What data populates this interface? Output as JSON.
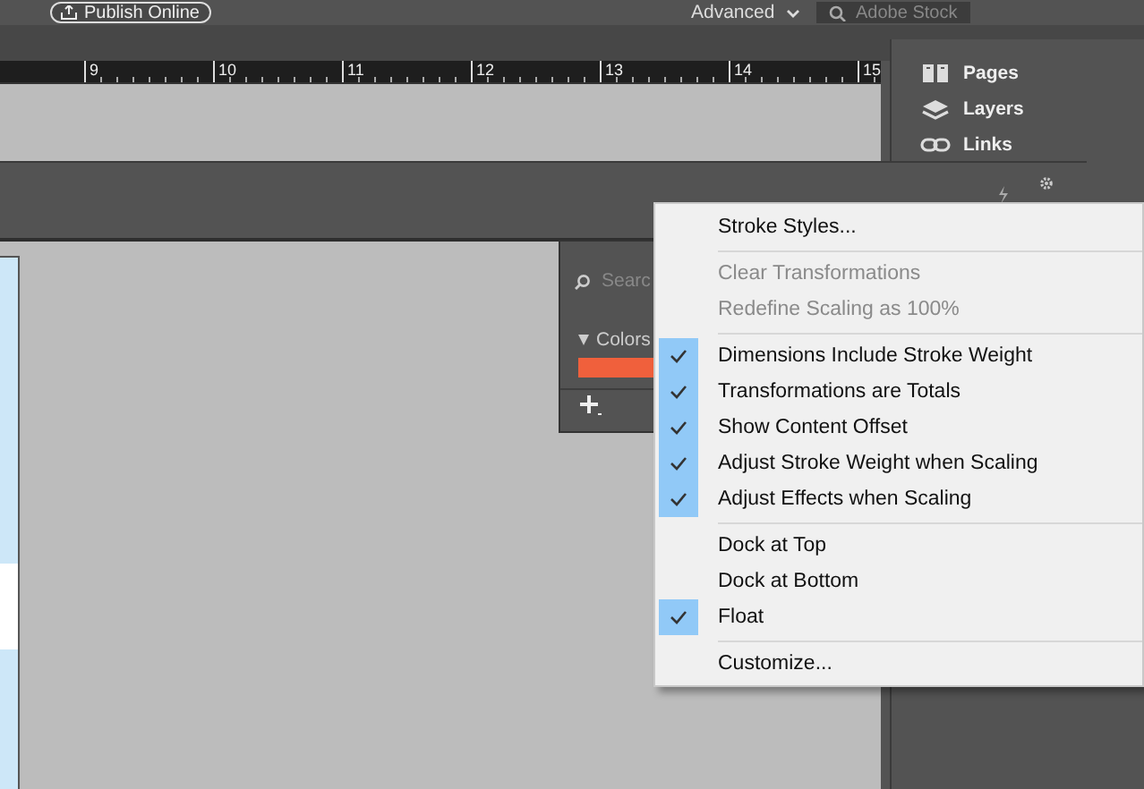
{
  "top_bar": {
    "publish_button": "Publish Online",
    "workspace": "Advanced",
    "search": {
      "placeholder": "Adobe Stock"
    }
  },
  "ruler": {
    "labels": [
      "9",
      "10",
      "11",
      "12",
      "13",
      "14",
      "15"
    ]
  },
  "dock": {
    "items": [
      {
        "label": "Pages",
        "kind": "pages"
      },
      {
        "label": "Layers",
        "kind": "layers"
      },
      {
        "label": "Links",
        "kind": "links"
      }
    ]
  },
  "swatches_panel": {
    "search": {
      "placeholder": "Searc"
    },
    "group": {
      "label": "Colors",
      "expanded": true
    },
    "swatches": [
      {
        "color": "#f0603c"
      }
    ]
  },
  "menu": {
    "items": [
      {
        "kind": "item",
        "label": "Stroke Styles...",
        "disabled": false,
        "checked": false
      },
      {
        "kind": "separator"
      },
      {
        "kind": "item",
        "label": "Clear Transformations",
        "disabled": true,
        "checked": false
      },
      {
        "kind": "item",
        "label": "Redefine Scaling as 100%",
        "disabled": true,
        "checked": false
      },
      {
        "kind": "separator"
      },
      {
        "kind": "item",
        "label": "Dimensions Include Stroke Weight",
        "disabled": false,
        "checked": true
      },
      {
        "kind": "item",
        "label": "Transformations are Totals",
        "disabled": false,
        "checked": true
      },
      {
        "kind": "item",
        "label": "Show Content Offset",
        "disabled": false,
        "checked": true
      },
      {
        "kind": "item",
        "label": "Adjust Stroke Weight when Scaling",
        "disabled": false,
        "checked": true
      },
      {
        "kind": "item",
        "label": "Adjust Effects when Scaling",
        "disabled": false,
        "checked": true
      },
      {
        "kind": "separator"
      },
      {
        "kind": "item",
        "label": "Dock at Top",
        "disabled": false,
        "checked": false
      },
      {
        "kind": "item",
        "label": "Dock at Bottom",
        "disabled": false,
        "checked": false
      },
      {
        "kind": "item",
        "label": "Float",
        "disabled": false,
        "checked": true
      },
      {
        "kind": "separator"
      },
      {
        "kind": "item",
        "label": "Customize...",
        "disabled": false,
        "checked": false
      }
    ]
  }
}
